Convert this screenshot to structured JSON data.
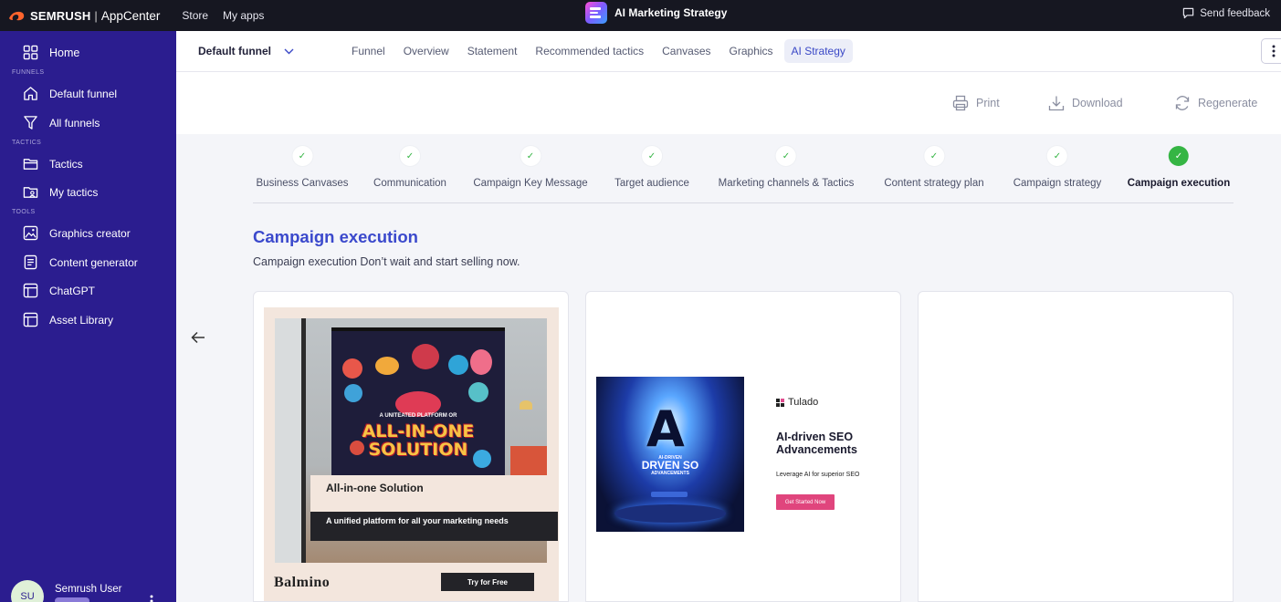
{
  "topbar": {
    "brand": "SEMRUSH",
    "separator": "|",
    "app_center": "AppCenter",
    "nav": [
      "Store",
      "My apps"
    ],
    "app_title": "AI Marketing Strategy",
    "feedback": "Send feedback"
  },
  "sidebar": {
    "home": "Home",
    "section_funnels": "FUNNELS",
    "default_funnel": "Default funnel",
    "all_funnels": "All funnels",
    "section_tactics": "TACTICS",
    "tactics": "Tactics",
    "my_tactics": "My tactics",
    "section_tools": "TOOLS",
    "graphics_creator": "Graphics creator",
    "content_generator": "Content generator",
    "chatgpt": "ChatGPT",
    "asset_library": "Asset Library",
    "user_initials": "SU",
    "user_name": "Semrush User"
  },
  "subheader": {
    "funnel_select": "Default funnel",
    "tabs": [
      "Funnel",
      "Overview",
      "Statement",
      "Recommended tactics",
      "Canvases",
      "Graphics",
      "AI Strategy"
    ],
    "active_tab": "AI Strategy"
  },
  "actions": {
    "print": "Print",
    "download": "Download",
    "regenerate": "Regenerate"
  },
  "steps": [
    {
      "label": "Business Canvases",
      "status": "done"
    },
    {
      "label": "Communication",
      "status": "done"
    },
    {
      "label": "Campaign Key Message",
      "status": "done"
    },
    {
      "label": "Target audience",
      "status": "done"
    },
    {
      "label": "Marketing channels & Tactics",
      "status": "done"
    },
    {
      "label": "Content strategy plan",
      "status": "done"
    },
    {
      "label": "Campaign strategy",
      "status": "done"
    },
    {
      "label": "Campaign execution",
      "status": "current"
    }
  ],
  "check_glyph": "✓",
  "content": {
    "title": "Campaign execution",
    "subtitle": "Campaign execution Don’t wait and start selling now."
  },
  "cards": {
    "card1": {
      "poster_small": "A UNITEATED PLATFORM OR",
      "poster_big_1": "ALL-IN-ONE",
      "poster_big_2": "SOLUTION",
      "heading": "All-in-one Solution",
      "subheading": "A unified platform for all your marketing needs",
      "brand": "Balmino",
      "cta": "Try for Free"
    },
    "card2": {
      "image_letter": "A",
      "image_text_1": "AI-DRIVEN",
      "image_text_2": "DRVEN SO",
      "image_text_3": "ADVANCEMENTS",
      "brand": "Tulado",
      "headline_1": "AI-driven SEO",
      "headline_2": "Advancements",
      "tagline": "Leverage AI for superior SEO",
      "cta": "Get Started Now"
    }
  },
  "colors": {
    "sidebar": "#2b1d8f",
    "topbar": "#161721",
    "accent_blue": "#3b49cc",
    "step_done": "#35b544",
    "cta_pink": "#e0457d"
  }
}
